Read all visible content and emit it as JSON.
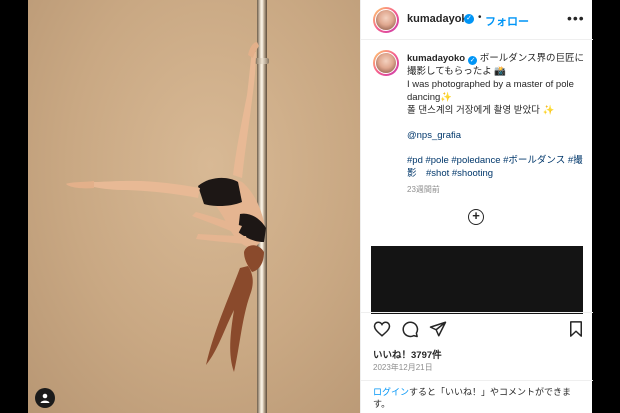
{
  "post": {
    "username": "kumadayoko",
    "verified_mark": "✓",
    "dot": "•",
    "follow_label": "フォロー",
    "more_label": "•••",
    "caption": {
      "line1": "ボールダンス界の巨匠に撮影してもらったよ",
      "line1_emoji": "📸",
      "line2": "I was photographed by a master of pole dancing",
      "line2_emoji": "✨",
      "line3": "폴 댄스계의 거장에게 촬영 받았다",
      "line3_emoji": "✨",
      "mention": "@nps_grafia",
      "hashtags": "#pd #pole #poledance #ボールダンス #撮影　#shot #shooting",
      "time_ago": "23週間前"
    },
    "add_comment_glyph": "+",
    "likes": "いいね！3797件",
    "date": "2023年12月21日",
    "login_prompt": {
      "link": "ログイン",
      "rest": "すると「いいね！」やコメントができます。"
    }
  },
  "colors": {
    "link_blue": "#0095f6",
    "mention_blue": "#00376b",
    "photo_background": "#c9a883",
    "text": "#262626",
    "muted": "#8e8e8e"
  },
  "icons": [
    "heart-icon",
    "comment-icon",
    "share-icon",
    "bookmark-icon",
    "profile-icon",
    "add-comment-icon",
    "verified-icon",
    "more-options-icon"
  ]
}
